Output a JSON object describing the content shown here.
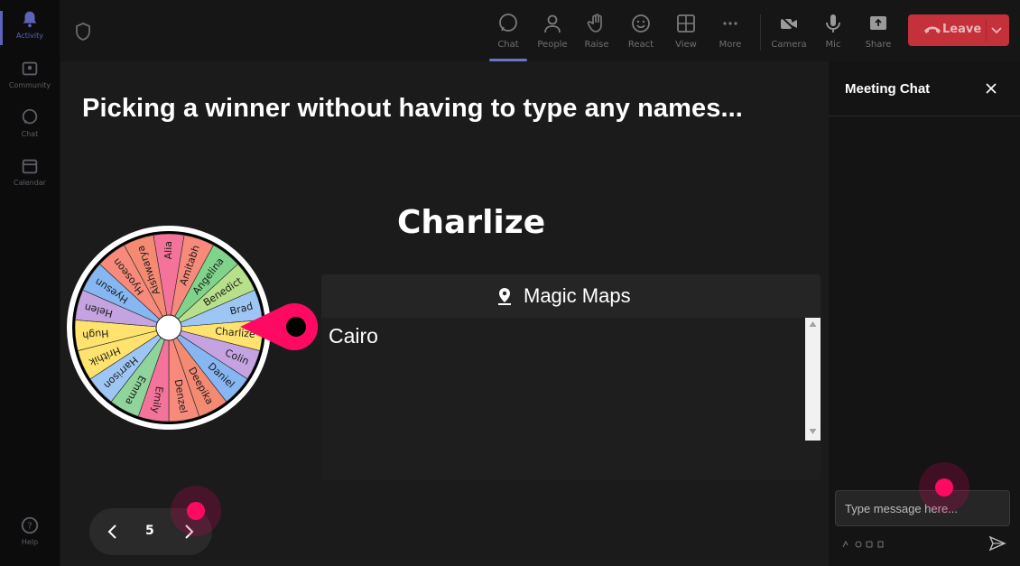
{
  "sidebar": {
    "items": [
      {
        "label": "Activity",
        "icon": "bell-icon",
        "active": true
      },
      {
        "label": "Community",
        "icon": "community-icon"
      },
      {
        "label": "Chat",
        "icon": "chat-icon"
      },
      {
        "label": "Calendar",
        "icon": "calendar-icon"
      }
    ],
    "help_label": "Help"
  },
  "toolbar": {
    "items": [
      {
        "label": "Chat",
        "icon": "chat-icon",
        "active": true
      },
      {
        "label": "People",
        "icon": "people-icon"
      },
      {
        "label": "Raise",
        "icon": "hand-icon"
      },
      {
        "label": "React",
        "icon": "smiley-icon"
      },
      {
        "label": "View",
        "icon": "grid-icon"
      },
      {
        "label": "More",
        "icon": "ellipsis-icon"
      },
      {
        "label": "Camera",
        "icon": "camera-icon"
      },
      {
        "label": "Mic",
        "icon": "mic-icon"
      },
      {
        "label": "Share",
        "icon": "share-icon"
      }
    ],
    "leave_label": "Leave"
  },
  "slide": {
    "title": "Picking a winner without having to type any names...",
    "winner": "Charlize",
    "wheel_names": [
      "Alia",
      "Amitabh",
      "Angelina",
      "Benedict",
      "Brad",
      "Charlize",
      "Colin",
      "Daniel",
      "Deepika",
      "Denzel",
      "Emily",
      "Emma",
      "Harrison",
      "Hrithik",
      "Hugh",
      "Helen",
      "Hyesun",
      "Hyoseon",
      "Aishwarya"
    ],
    "wheel_colors": [
      "#f4739a",
      "#f78a7a",
      "#7fd38b",
      "#b7e08a",
      "#9ec6f5",
      "#ffe36e",
      "#c4a3e0",
      "#86b7f2",
      "#f58a73",
      "#f78a7a",
      "#f4739a",
      "#8fd49a",
      "#9ec6f5",
      "#ffe36e",
      "#ffe36e",
      "#c4a3e0",
      "#86b7f2",
      "#f78a7a",
      "#f58a73"
    ],
    "accent": "#ff0a62"
  },
  "maps": {
    "title": "Magic Maps",
    "value": "Cairo"
  },
  "pager": {
    "page": "5"
  },
  "chat": {
    "title": "Meeting Chat",
    "placeholder": "Type message here..."
  }
}
